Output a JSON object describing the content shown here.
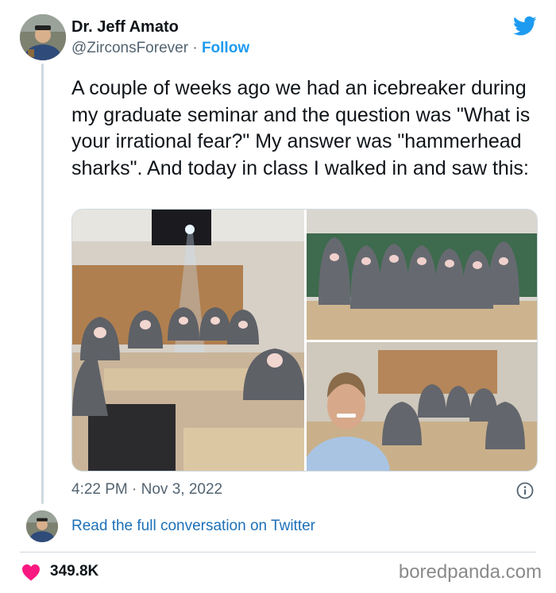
{
  "author": {
    "name": "Dr. Jeff Amato",
    "handle": "@ZirconsForever",
    "separator": "·",
    "follow_label": "Follow"
  },
  "tweet": {
    "text": "A couple of weeks ago we had an icebreaker during my graduate seminar and the question was \"What is your irrational fear?\" My answer was \"hammerhead sharks\". And today in class I walked in and saw this:",
    "timestamp": "4:22 PM · Nov 3, 2022"
  },
  "footer": {
    "read_link": "Read the full conversation on Twitter",
    "likes": "349.8K"
  },
  "credit": "boredpanda.com",
  "icons": {
    "logo": "twitter-bird-icon",
    "info": "info-icon",
    "like": "heart-icon"
  },
  "colors": {
    "accent": "#1d9bf0",
    "link": "#1d70b8",
    "heart": "#f91880",
    "muted": "#536471"
  }
}
